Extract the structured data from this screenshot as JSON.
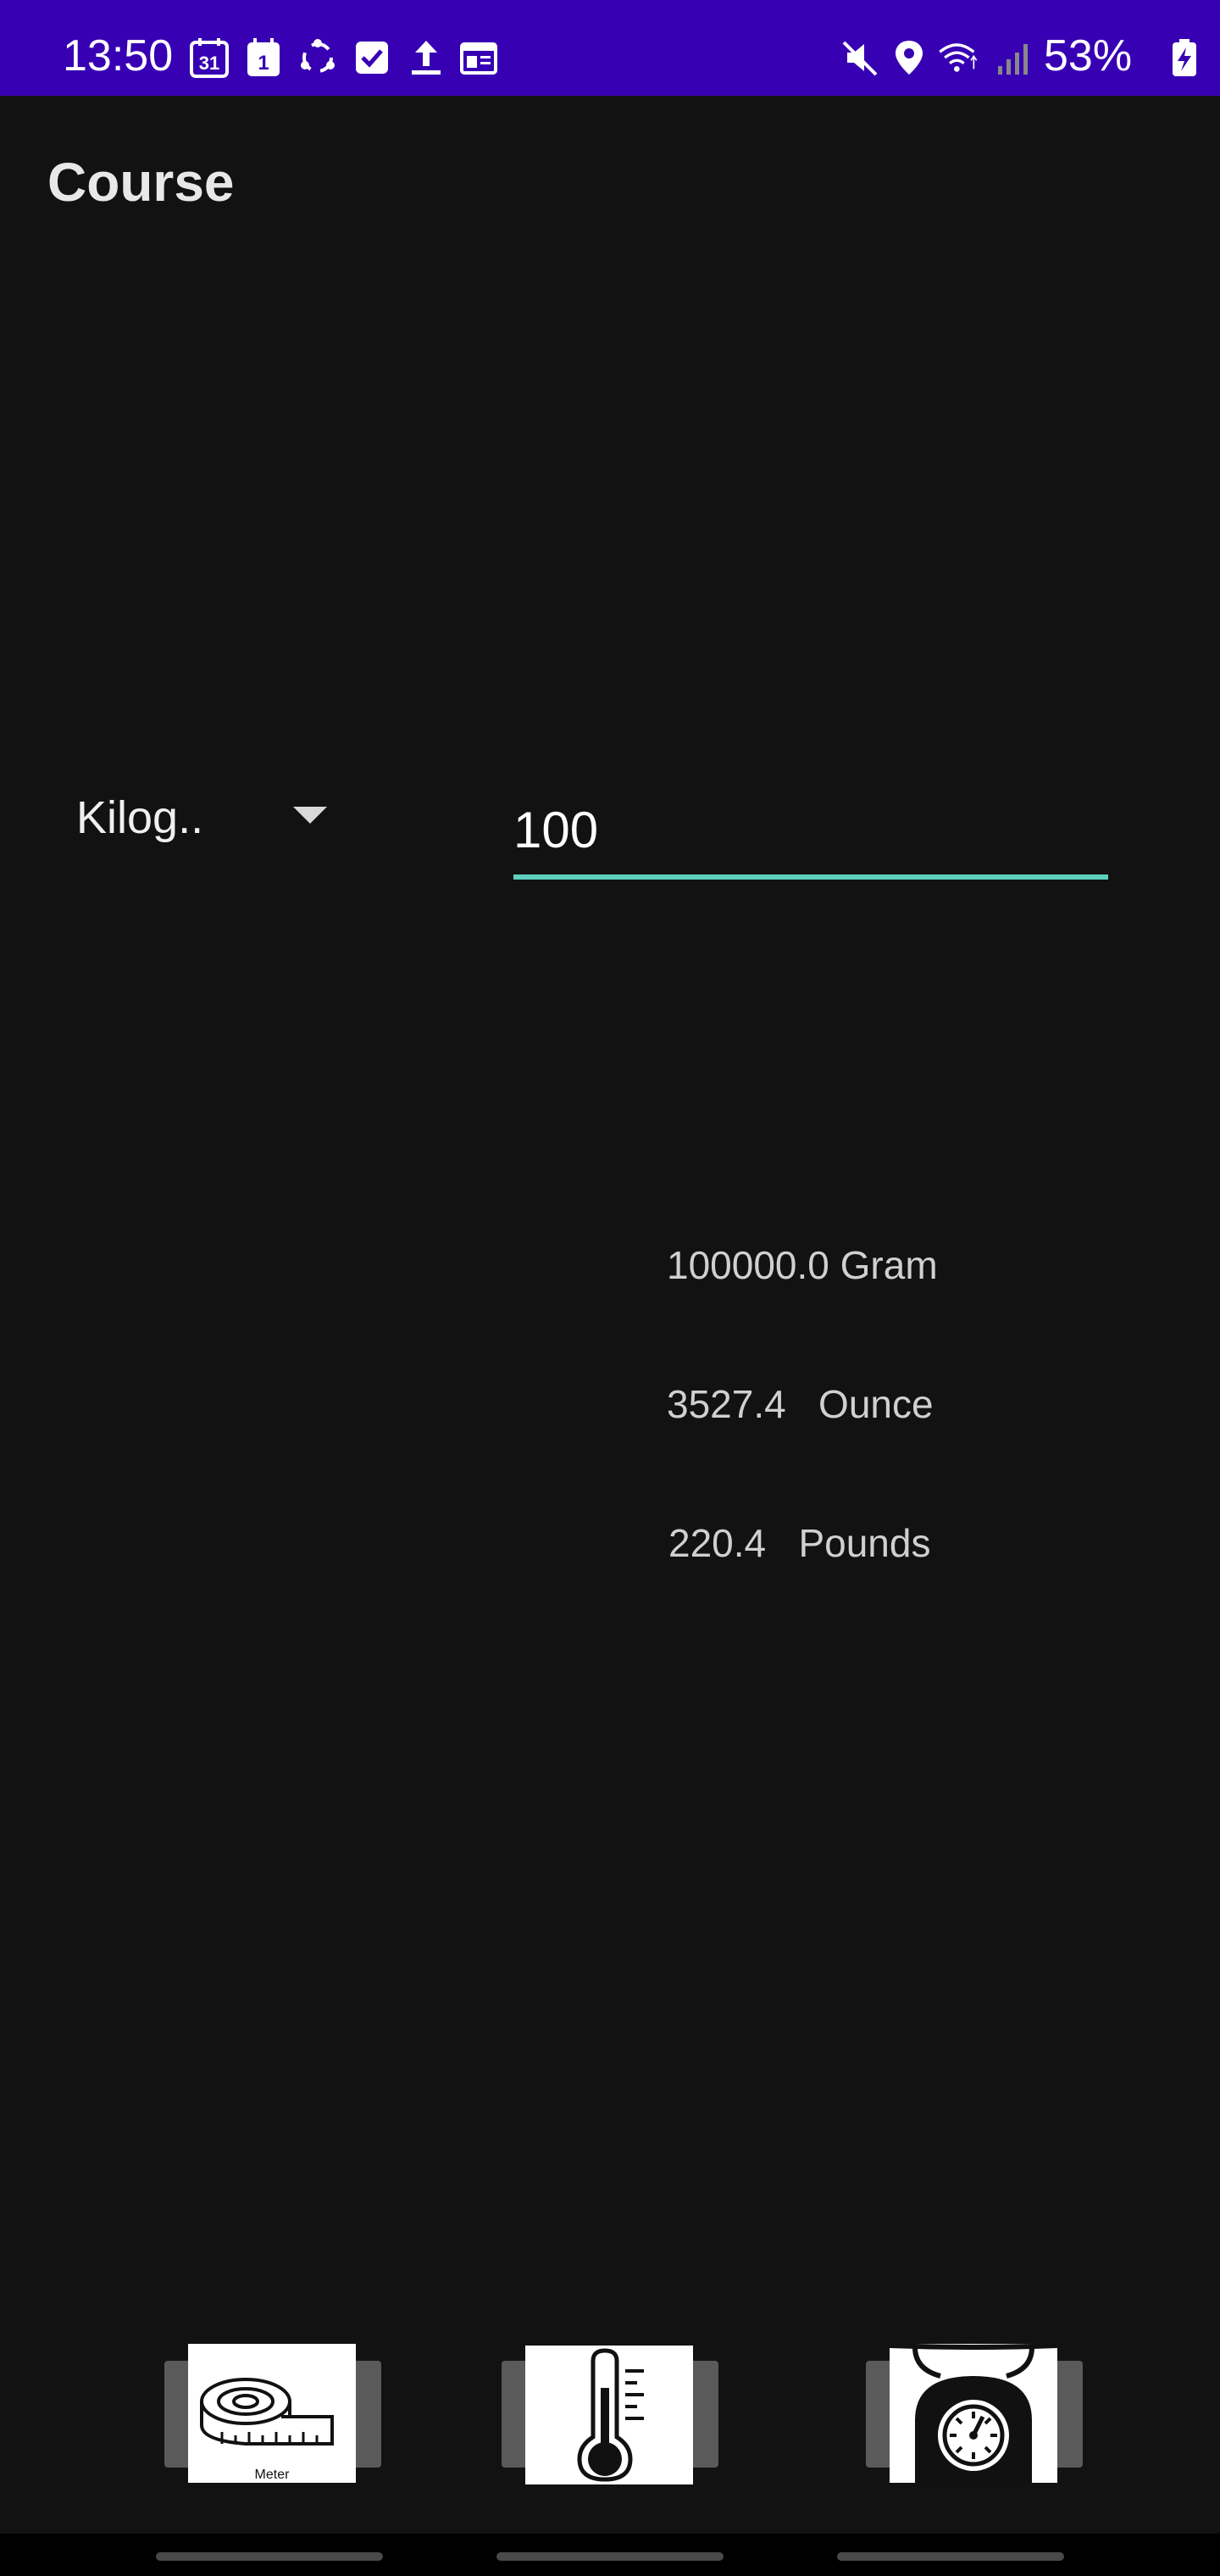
{
  "status_bar": {
    "time": "13:50",
    "calendar_day": "31",
    "calendar_badge": "1",
    "battery_percent": "53%",
    "left_icons": [
      "calendar-icon",
      "calendar-badge-icon",
      "sync-icon",
      "checkbox-icon",
      "upload-icon",
      "news-icon"
    ],
    "right_icons": [
      "mute-icon",
      "location-icon",
      "wifi-icon",
      "signal-icon",
      "battery-charging-icon"
    ]
  },
  "app": {
    "title": "Course"
  },
  "converter": {
    "selected_unit": "Kilog..",
    "input_value": "100"
  },
  "results": [
    {
      "text": "100000.0 Gram"
    },
    {
      "text": "3527.4   Ounce"
    },
    {
      "text": "220.4   Pounds"
    }
  ],
  "bottom_nav": {
    "items": [
      {
        "icon": "tape-measure-icon",
        "caption": "Meter"
      },
      {
        "icon": "thermometer-icon",
        "caption": ""
      },
      {
        "icon": "kitchen-scale-icon",
        "caption": ""
      }
    ]
  },
  "colors": {
    "status_bar": "#3700b3",
    "background": "#121212",
    "input_underline": "#5fd0bf"
  }
}
